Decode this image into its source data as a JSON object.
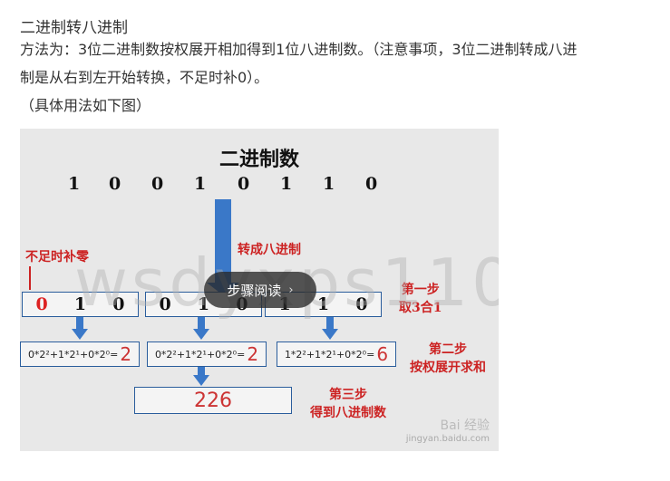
{
  "article": {
    "title": "二进制转八进制",
    "para1_line1": "方法为：3位二进制数按权展开相加得到1位八进制数。（注意事项，3位二进制转成八进",
    "para1_line2": "制是从右到左开始转换，不足时补0）。",
    "para2": "（具体用法如下图）"
  },
  "figure": {
    "title": "二进制数",
    "bits": [
      "1",
      "0",
      "0",
      "1",
      "0",
      "1",
      "1",
      "0"
    ],
    "pad_label": "不足时补零",
    "convert_label": "转成八进制",
    "groups": [
      {
        "digits": [
          "0",
          "1",
          "0"
        ]
      },
      {
        "digits": [
          "0",
          "1",
          "0"
        ]
      },
      {
        "digits": [
          "1",
          "1",
          "0"
        ]
      }
    ],
    "formulas": [
      {
        "expr": "0*2²+1*2¹+0*2⁰=",
        "value": "2"
      },
      {
        "expr": "0*2²+1*2¹+0*2⁰=",
        "value": "2"
      },
      {
        "expr": "1*2²+1*2¹+0*2⁰=",
        "value": "6"
      }
    ],
    "result": "226",
    "step1_line1": "第一步",
    "step1_line2": "取3合1",
    "step2_line1": "第二步",
    "step2_line2": "按权展开求和",
    "step3_line1": "第三步",
    "step3_line2": "得到八进制数",
    "watermark": "wsdyxps110",
    "baidu": "Bai 经验",
    "baidu_url": "jingyan.baidu.com"
  },
  "overlay": {
    "label": "步骤阅读",
    "icon": "chevron-right-icon"
  }
}
